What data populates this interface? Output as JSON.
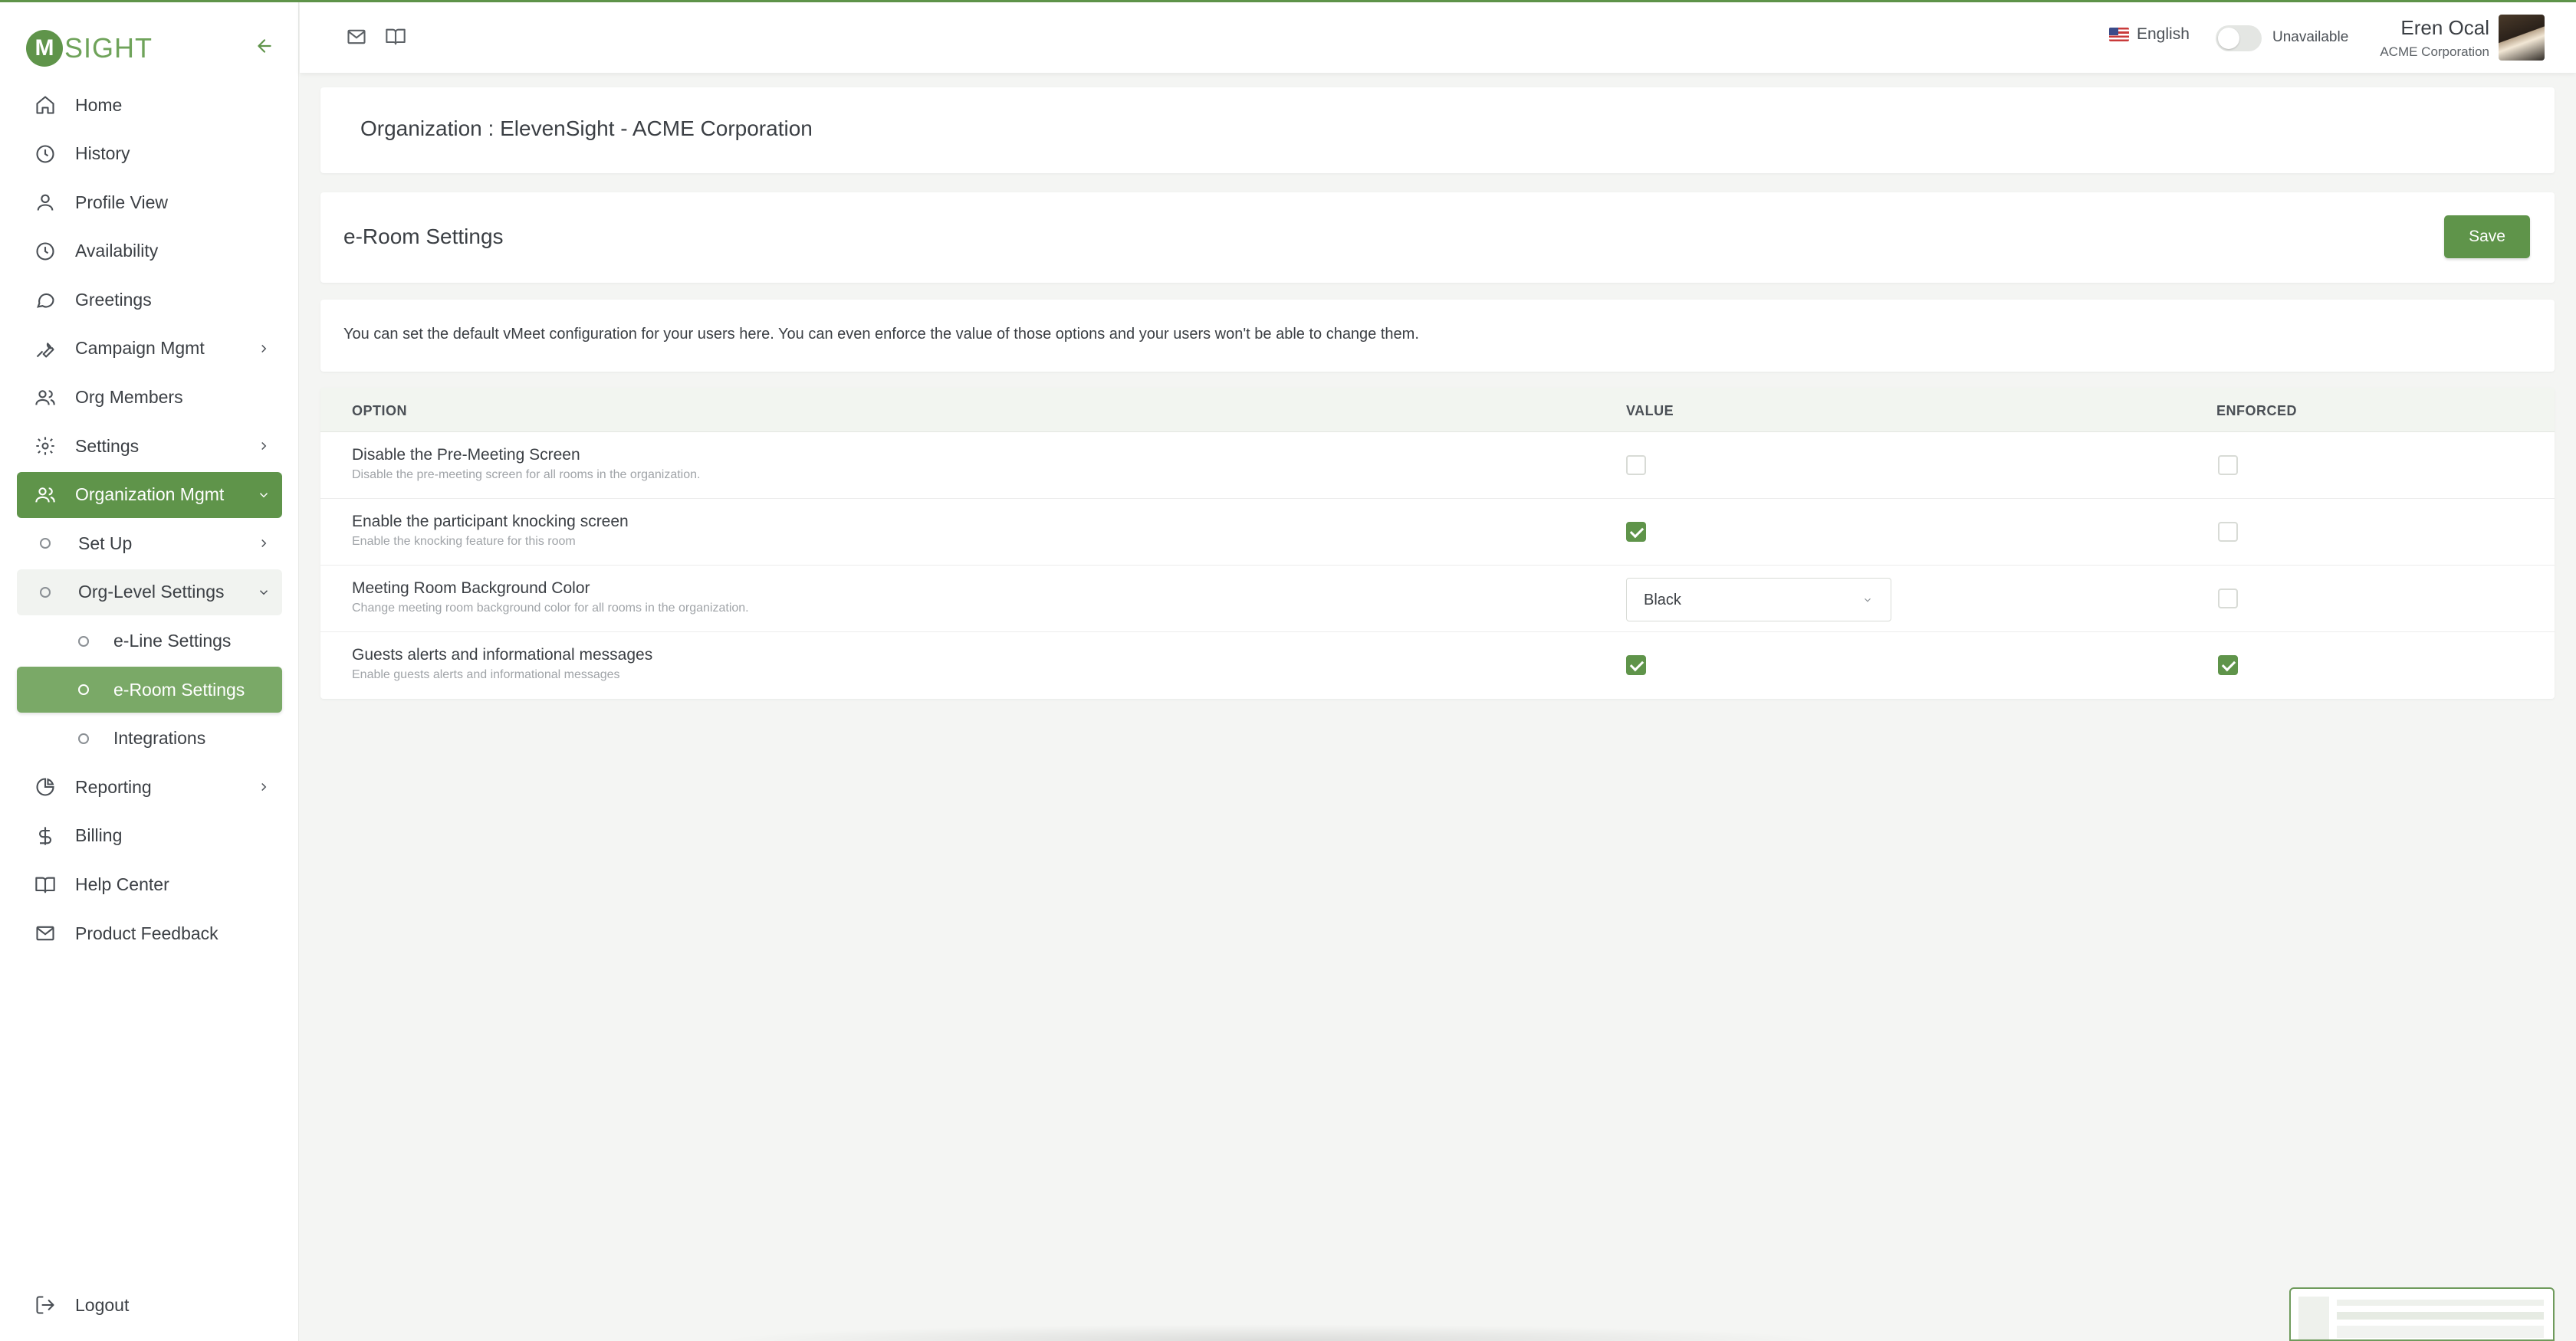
{
  "brand": {
    "logo_letter": "M",
    "logo_text": "SIGHT",
    "accent": "#5f944a"
  },
  "sidebar": {
    "items": [
      {
        "label": "Home",
        "icon": "home-icon"
      },
      {
        "label": "History",
        "icon": "clock-icon"
      },
      {
        "label": "Profile View",
        "icon": "user-icon"
      },
      {
        "label": "Availability",
        "icon": "clock-icon"
      },
      {
        "label": "Greetings",
        "icon": "chat-bubble-icon"
      },
      {
        "label": "Campaign Mgmt",
        "icon": "wrench-icon",
        "has_children": true
      },
      {
        "label": "Org Members",
        "icon": "users-icon"
      },
      {
        "label": "Settings",
        "icon": "gear-icon",
        "has_children": true
      },
      {
        "label": "Organization Mgmt",
        "icon": "users-icon",
        "active": true,
        "expanded": true
      },
      {
        "label": "Set Up",
        "level": 1,
        "has_children": true
      },
      {
        "label": "Org-Level Settings",
        "level": 1,
        "expanded": true
      },
      {
        "label": "e-Line Settings",
        "level": 2
      },
      {
        "label": "e-Room Settings",
        "level": 2,
        "selected": true
      },
      {
        "label": "Integrations",
        "level": 2
      },
      {
        "label": "Reporting",
        "icon": "pie-chart-icon",
        "has_children": true
      },
      {
        "label": "Billing",
        "icon": "dollar-icon"
      },
      {
        "label": "Help Center",
        "icon": "book-icon"
      },
      {
        "label": "Product Feedback",
        "icon": "mail-icon"
      }
    ],
    "logout_label": "Logout"
  },
  "topbar": {
    "language": "English",
    "status_label": "Unavailable",
    "status_on": false,
    "user_name": "Eren Ocal",
    "user_org": "ACME Corporation"
  },
  "main": {
    "org_title": "Organization : ElevenSight - ACME Corporation",
    "settings_title": "e-Room Settings",
    "save_label": "Save",
    "description": "You can set the default vMeet configuration for your users here. You can even enforce the value of those options and your users won't be able to change them.",
    "table": {
      "headers": {
        "option": "OPTION",
        "value": "VALUE",
        "enforced": "ENFORCED"
      },
      "rows": [
        {
          "title": "Disable the Pre-Meeting Screen",
          "desc": "Disable the pre-meeting screen for all rooms in the organization.",
          "value_type": "checkbox",
          "value": false,
          "enforced": false
        },
        {
          "title": "Enable the participant knocking screen",
          "desc": "Enable the knocking feature for this room",
          "value_type": "checkbox",
          "value": true,
          "enforced": false
        },
        {
          "title": "Meeting Room Background Color",
          "desc": "Change meeting room background color for all rooms in the organization.",
          "value_type": "select",
          "value": "Black",
          "enforced": false
        },
        {
          "title": "Guests alerts and informational messages",
          "desc": "Enable guests alerts and informational messages",
          "value_type": "checkbox",
          "value": true,
          "enforced": true
        }
      ]
    }
  }
}
